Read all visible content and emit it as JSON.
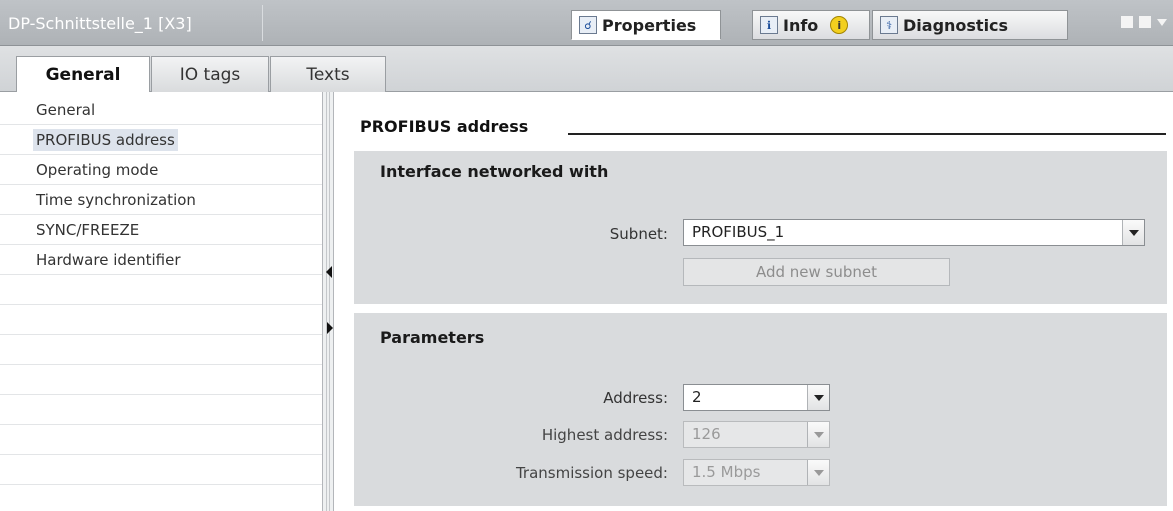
{
  "window": {
    "title": "DP-Schnittstelle_1 [X3]",
    "tabs": [
      {
        "label": "Properties",
        "icon": "properties-icon",
        "active": true
      },
      {
        "label": "Info",
        "icon": "info-tab-icon",
        "active": false
      },
      {
        "label": "Diagnostics",
        "icon": "diagnostics-icon",
        "active": false
      }
    ],
    "info_badge": "i"
  },
  "subtabs": [
    {
      "label": "General",
      "active": true
    },
    {
      "label": "IO tags",
      "active": false
    },
    {
      "label": "Texts",
      "active": false
    }
  ],
  "nav": {
    "items": [
      "General",
      "PROFIBUS address",
      "Operating mode",
      "Time synchronization",
      "SYNC/FREEZE",
      "Hardware identifier"
    ],
    "selected": "PROFIBUS address"
  },
  "main": {
    "section_title": "PROFIBUS address",
    "interface_panel": {
      "title": "Interface networked with",
      "subnet_label": "Subnet:",
      "subnet_value": "PROFIBUS_1",
      "add_button": "Add new subnet"
    },
    "parameters_panel": {
      "title": "Parameters",
      "address_label": "Address:",
      "address_value": "2",
      "highest_label": "Highest address:",
      "highest_value": "126",
      "speed_label": "Transmission speed:",
      "speed_value": "1.5 Mbps"
    }
  },
  "colors": {
    "titlebar": "#b3b7bb",
    "panel": "#d9dbdd",
    "selection": "#dde3ec"
  }
}
